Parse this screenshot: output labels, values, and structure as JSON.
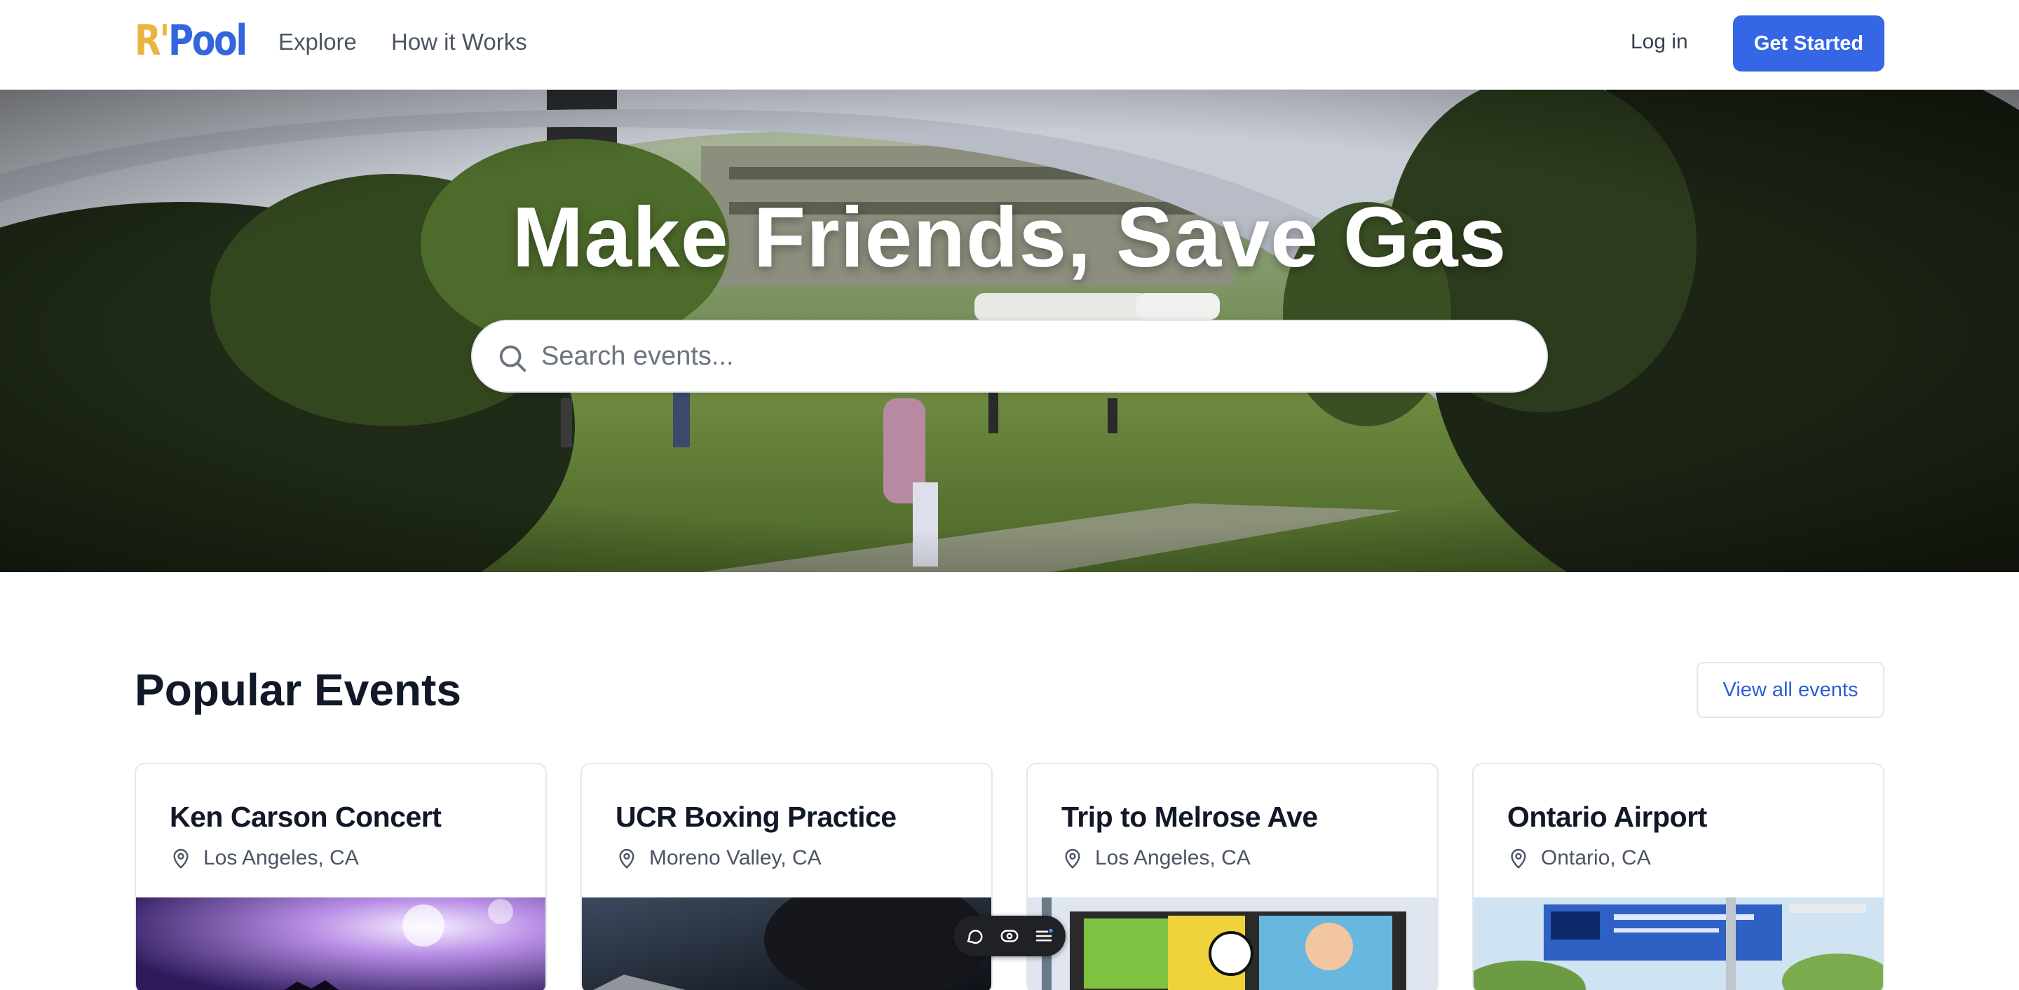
{
  "brand": {
    "logo_part1": "R'",
    "logo_part2": "Pool"
  },
  "nav": {
    "links": [
      {
        "label": "Explore"
      },
      {
        "label": "How it Works"
      }
    ],
    "login_label": "Log in",
    "cta_label": "Get Started"
  },
  "hero": {
    "title": "Make Friends, Save Gas",
    "search_placeholder": "Search events...",
    "search_value": ""
  },
  "popular": {
    "title": "Popular Events",
    "view_all_label": "View all events",
    "events": [
      {
        "title": "Ken Carson Concert",
        "location": "Los Angeles, CA"
      },
      {
        "title": "UCR Boxing Practice",
        "location": "Moreno Valley, CA"
      },
      {
        "title": "Trip to Melrose Ave",
        "location": "Los Angeles, CA"
      },
      {
        "title": "Ontario Airport",
        "location": "Ontario, CA"
      }
    ]
  },
  "toolbar": {
    "icons": [
      "comment-icon",
      "eye-icon",
      "menu-list-icon"
    ]
  },
  "colors": {
    "primary": "#3466e5",
    "logo_gold": "#e9b440",
    "logo_blue": "#3366dd",
    "text_dark": "#111827"
  }
}
